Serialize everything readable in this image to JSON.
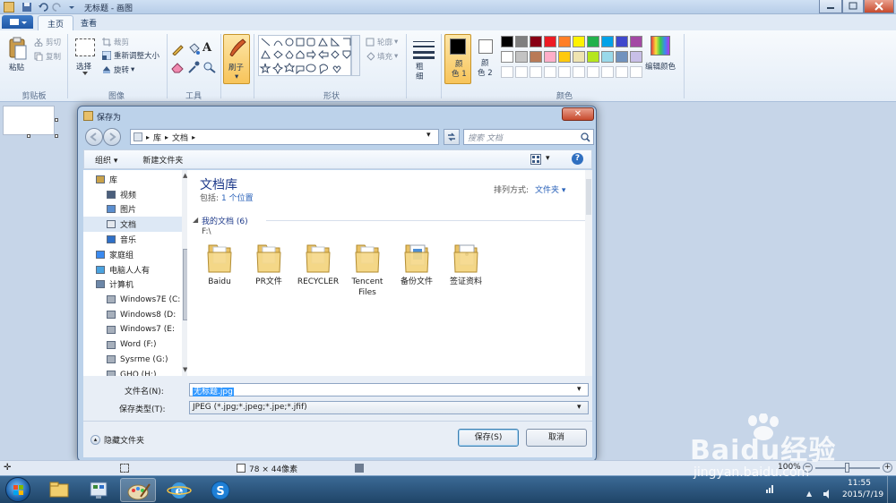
{
  "window": {
    "title": "无标题 - 画图"
  },
  "ribbon": {
    "tabs": [
      "主页",
      "查看"
    ],
    "clipboard": {
      "paste": "粘贴",
      "cut": "剪切",
      "copy": "复制",
      "label": "剪贴板"
    },
    "image": {
      "select": "选择",
      "crop": "裁剪",
      "resize": "重新调整大小",
      "rotate": "旋转",
      "label": "图像"
    },
    "tools": {
      "label": "工具"
    },
    "brushes": {
      "label": "刷子"
    },
    "shapes": {
      "outline": "轮廓",
      "fill": "填充",
      "label": "形状"
    },
    "size": {
      "label": "粗\n细"
    },
    "colors": {
      "color1": "颜\n色 1",
      "color2": "颜\n色 2",
      "edit": "编辑颜色",
      "label": "颜色",
      "palette_row1": [
        "#000000",
        "#7f7f7f",
        "#880015",
        "#ed1c24",
        "#ff7f27",
        "#fff200",
        "#22b14c",
        "#00a2e8",
        "#3f48cc",
        "#a349a4"
      ],
      "palette_row2": [
        "#ffffff",
        "#c3c3c3",
        "#b97a57",
        "#ffaec9",
        "#ffc90e",
        "#efe4b0",
        "#b5e61d",
        "#99d9ea",
        "#7092be",
        "#c8bfe7"
      ]
    }
  },
  "dialog": {
    "title": "保存为",
    "breadcrumb": [
      "库",
      "文档"
    ],
    "search_placeholder": "搜索 文档",
    "organize": "组织 ▾",
    "new_folder": "新建文件夹",
    "nav": [
      {
        "label": "库",
        "icon": "library-icon",
        "indent": 0
      },
      {
        "label": "视频",
        "icon": "video-icon",
        "indent": 1
      },
      {
        "label": "图片",
        "icon": "picture-icon",
        "indent": 1
      },
      {
        "label": "文档",
        "icon": "document-icon",
        "indent": 1,
        "selected": true
      },
      {
        "label": "音乐",
        "icon": "music-icon",
        "indent": 1
      },
      {
        "label": "家庭组",
        "icon": "homegroup-icon",
        "indent": 0
      },
      {
        "label": "电脑人人有",
        "icon": "user-icon",
        "indent": 0
      },
      {
        "label": "计算机",
        "icon": "computer-icon",
        "indent": 0
      },
      {
        "label": "Windows7E (C:",
        "icon": "drive-icon",
        "indent": 1
      },
      {
        "label": "Windows8 (D:",
        "icon": "drive-icon",
        "indent": 1
      },
      {
        "label": "Windows7 (E:",
        "icon": "drive-icon",
        "indent": 1
      },
      {
        "label": "Word (F:)",
        "icon": "drive-icon",
        "indent": 1
      },
      {
        "label": "Sysrme (G:)",
        "icon": "drive-icon",
        "indent": 1
      },
      {
        "label": "GHO (H:)",
        "icon": "drive-icon",
        "indent": 1
      }
    ],
    "library_title": "文档库",
    "includes_label": "包括:",
    "includes_link": "1 个位置",
    "arrange_label": "排列方式:",
    "arrange_value": "文件夹 ▾",
    "group_header": "我的文档 (6)",
    "group_path": "F:\\",
    "folders": [
      "Baidu",
      "PR文件",
      "RECYCLER",
      "Tencent Files",
      "备份文件",
      "签证资料"
    ],
    "filename_label": "文件名(N):",
    "filename_value": "无标题.jpg",
    "filetype_label": "保存类型(T):",
    "filetype_value": "JPEG (*.jpg;*.jpeg;*.jpe;*.jfif)",
    "hide_folders": "隐藏文件夹",
    "save_button": "保存(S)",
    "cancel_button": "取消"
  },
  "statusbar": {
    "size": "78 × 44像素",
    "zoom": "100%"
  },
  "taskbar": {
    "time": "11:55",
    "date": "2015/7/19"
  },
  "watermark": {
    "line1": "Baidu经验",
    "line2": "jingyan.baidu.com"
  }
}
